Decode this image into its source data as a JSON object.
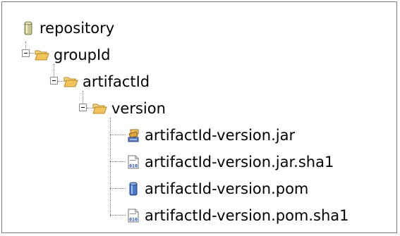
{
  "tree": {
    "root": {
      "label": "repository",
      "icon": "repository-cylinder-icon",
      "color": "#a8a870"
    },
    "group": {
      "label": "groupId",
      "icon": "folder-open-icon",
      "expanded": true
    },
    "artifact": {
      "label": "artifactId",
      "icon": "folder-open-icon",
      "expanded": true
    },
    "version": {
      "label": "version",
      "icon": "folder-open-icon",
      "expanded": true
    },
    "files": [
      {
        "label": "artifactId-version.jar",
        "icon": "jar-file-icon"
      },
      {
        "label": "artifactId-version.jar.sha1",
        "icon": "binary-file-icon"
      },
      {
        "label": "artifactId-version.pom",
        "icon": "pom-file-icon"
      },
      {
        "label": "artifactId-version.pom.sha1",
        "icon": "binary-file-icon"
      }
    ]
  },
  "colors": {
    "folder": "#f0c060",
    "folder_edge": "#c08a20",
    "pom": "#4a78c8",
    "border": "#7f7f7f"
  }
}
